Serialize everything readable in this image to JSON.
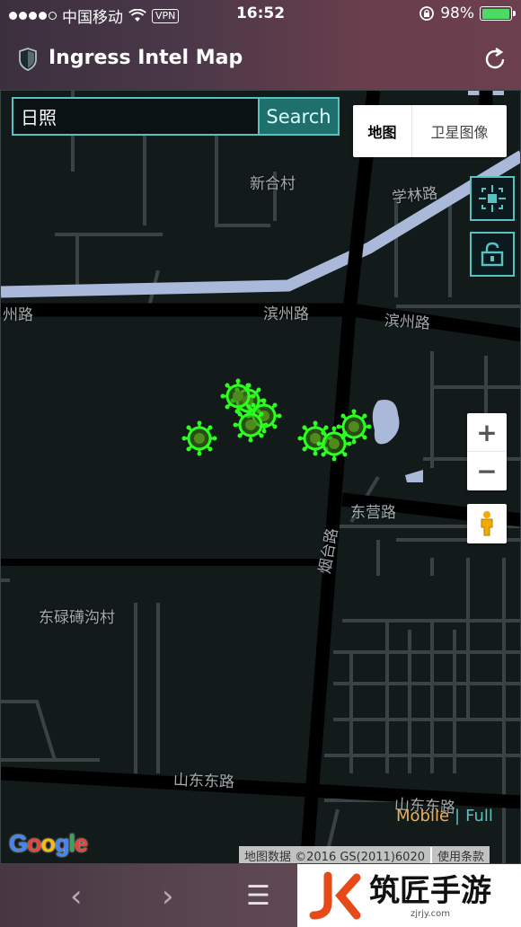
{
  "status_bar": {
    "carrier": "中国移动",
    "vpn": "VPN",
    "time": "16:52",
    "battery": "98%",
    "battery_level": 0.98
  },
  "app": {
    "title": "Ingress Intel Map"
  },
  "search": {
    "value": "日照",
    "button": "Search"
  },
  "map_type": {
    "map": "地图",
    "satellite": "卫星图像",
    "selected": "地图"
  },
  "zoom": {
    "plus": "+",
    "minus": "−"
  },
  "map_labels": {
    "xinhe": "新合村",
    "xuelin": "学林路",
    "binzhou_left": "州路",
    "binzhou_mid": "滨州路",
    "binzhou_right": "滨州路",
    "dongying": "东营路",
    "yantai": "烟台路",
    "donglu": "东碌礡沟村",
    "shandong_mid": "山东东路",
    "shandong_right": "山东东路"
  },
  "links": {
    "mobile": "Mobile",
    "separator": "|",
    "full": "Full"
  },
  "attribution": {
    "google": "Google",
    "data": "地图数据 ©2016 GS(2011)6020",
    "terms": "使用条款"
  },
  "bottom_bar": {
    "back": "‹",
    "forward": "›",
    "menu": "☰"
  },
  "watermark": {
    "name": "筑匠手游",
    "url": "zjrjy.com"
  },
  "colors": {
    "accent": "#59c1c2",
    "portal": "#2bff1f",
    "mobile": "#ebb058"
  }
}
